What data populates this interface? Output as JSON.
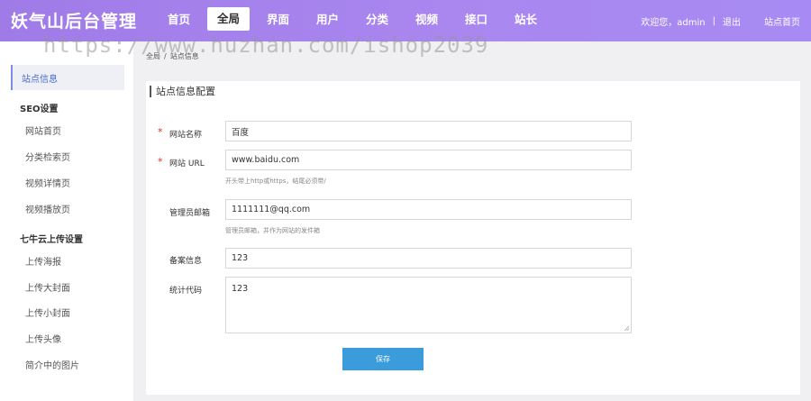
{
  "header": {
    "brand": "妖气山后台管理",
    "nav": [
      "首页",
      "全局",
      "界面",
      "用户",
      "分类",
      "视频",
      "接口",
      "站长"
    ],
    "active_nav": "全局",
    "welcome": "欢迎您，admin",
    "divider": "|",
    "logout": "退出",
    "site_home": "站点首页"
  },
  "watermark": "https://www.huzhan.com/ishop2039",
  "sidebar": {
    "active": "站点信息",
    "group_seo": "SEO设置",
    "seo_items": [
      "网站首页",
      "分类检索页",
      "视频详情页",
      "视频播放页"
    ],
    "group_qiniu": "七牛云上传设置",
    "qiniu_items": [
      "上传海报",
      "上传大封面",
      "上传小封面",
      "上传头像",
      "简介中的图片"
    ]
  },
  "breadcrumb": [
    "全局",
    "站点信息"
  ],
  "panel": {
    "title": "站点信息配置",
    "fields": {
      "site_name": {
        "label": "网站名称",
        "value": "百度"
      },
      "site_url": {
        "label": "网站 URL",
        "value": "www.baidu.com",
        "hint": "开头带上http或https，结尾必须带/"
      },
      "admin_email": {
        "label": "管理员邮箱",
        "value": "1111111@qq.com",
        "hint": "管理员邮箱，并作为网站的发件箱"
      },
      "icp": {
        "label": "备案信息",
        "value": "123"
      },
      "stats_code": {
        "label": "统计代码",
        "value": "123"
      }
    },
    "save": "保存"
  },
  "colors": {
    "header_gradient_start": "#9f7be8",
    "header_gradient_end": "#a78af3",
    "save_button": "#3a9cda",
    "required_star": "#e0312b",
    "active_side_text": "#4a6bd0"
  }
}
